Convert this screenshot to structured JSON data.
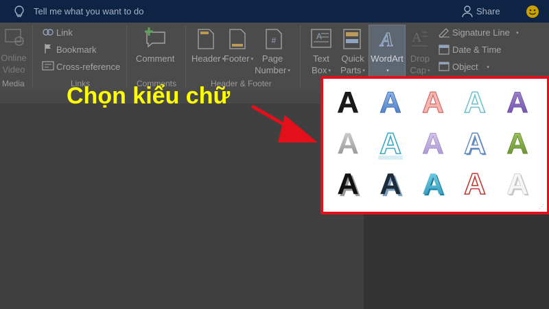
{
  "topbar": {
    "tell_me": "Tell me what you want to do",
    "share": "Share",
    "icons": [
      "lightbulb-icon",
      "person-icon",
      "smiley-icon"
    ]
  },
  "ribbon": {
    "media": {
      "line1": "Online",
      "line2": "Video",
      "group": "Media"
    },
    "links": {
      "link": "Link",
      "bookmark": "Bookmark",
      "cross_reference": "Cross-reference",
      "group": "Links"
    },
    "comments": {
      "comment": "Comment",
      "group": "Comments"
    },
    "header_footer": {
      "header": "Header",
      "footer": "Footer",
      "page_number_line1": "Page",
      "page_number_line2": "Number",
      "group": "Header & Footer"
    },
    "text": {
      "text_box_line1": "Text",
      "text_box_line2": "Box",
      "quick_parts_line1": "Quick",
      "quick_parts_line2": "Parts",
      "wordart": "WordArt",
      "drop_cap_line1": "Drop",
      "drop_cap_line2": "Cap",
      "signature_line": "Signature Line",
      "date_time": "Date & Time",
      "object": "Object"
    },
    "caret": "▾"
  },
  "annotation": {
    "text": "Chọn kiểu chữ",
    "color": "#ffff00",
    "arrow_color": "#e3101b"
  },
  "gallery": {
    "letter": "A",
    "border_color": "#e3101b",
    "styles": [
      [
        "black-outline",
        "blue-gradient",
        "pink-outline",
        "light-blue-outline",
        "purple-gradient"
      ],
      [
        "gray-gradient",
        "teal-reflection",
        "lavender",
        "light-blue-shadow",
        "green-gradient"
      ],
      [
        "black-shadow",
        "dark-blue-shadow",
        "teal-3d",
        "red-outline",
        "white-bevel"
      ]
    ],
    "resize_grip": "⋰"
  }
}
